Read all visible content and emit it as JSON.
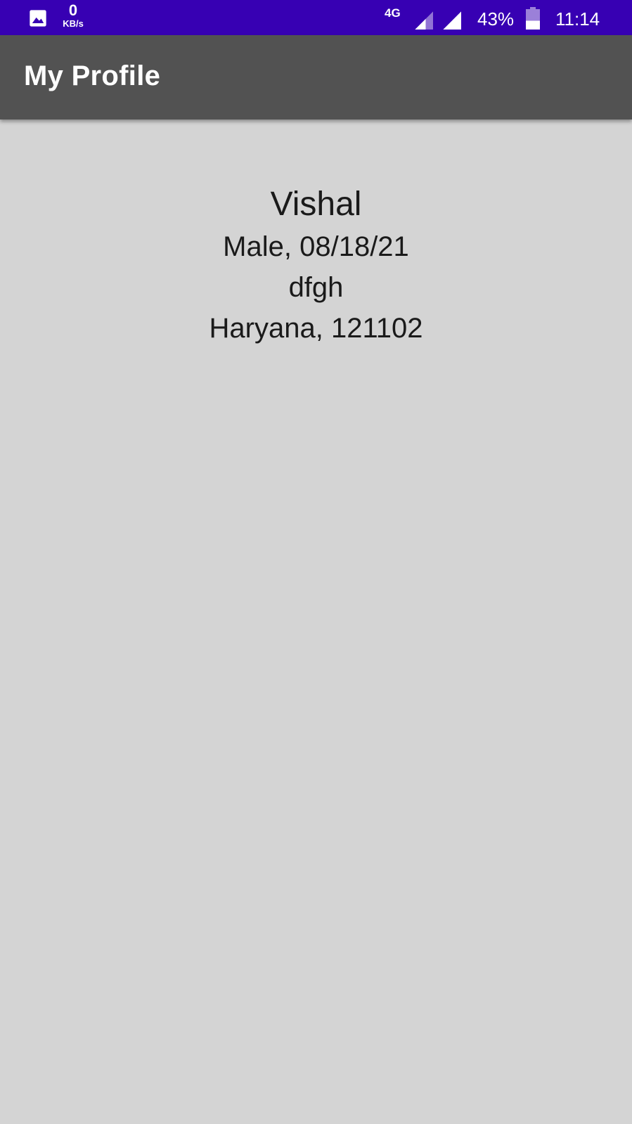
{
  "status_bar": {
    "image_icon": "image-icon",
    "speed_value": "0",
    "speed_unit": "KB/s",
    "network_type": "4G",
    "battery_percent": "43%",
    "battery_level": 0.43,
    "time": "11:14",
    "background_color": "#3700b3"
  },
  "app_bar": {
    "title": "My Profile",
    "background_color": "#525252"
  },
  "profile": {
    "name": "Vishal",
    "gender_dob": "Male, 08/18/21",
    "address": "dfgh",
    "state_pin": "Haryana, 121102"
  },
  "colors": {
    "page_background": "#d4d4d4",
    "text": "#1a1a1a"
  }
}
